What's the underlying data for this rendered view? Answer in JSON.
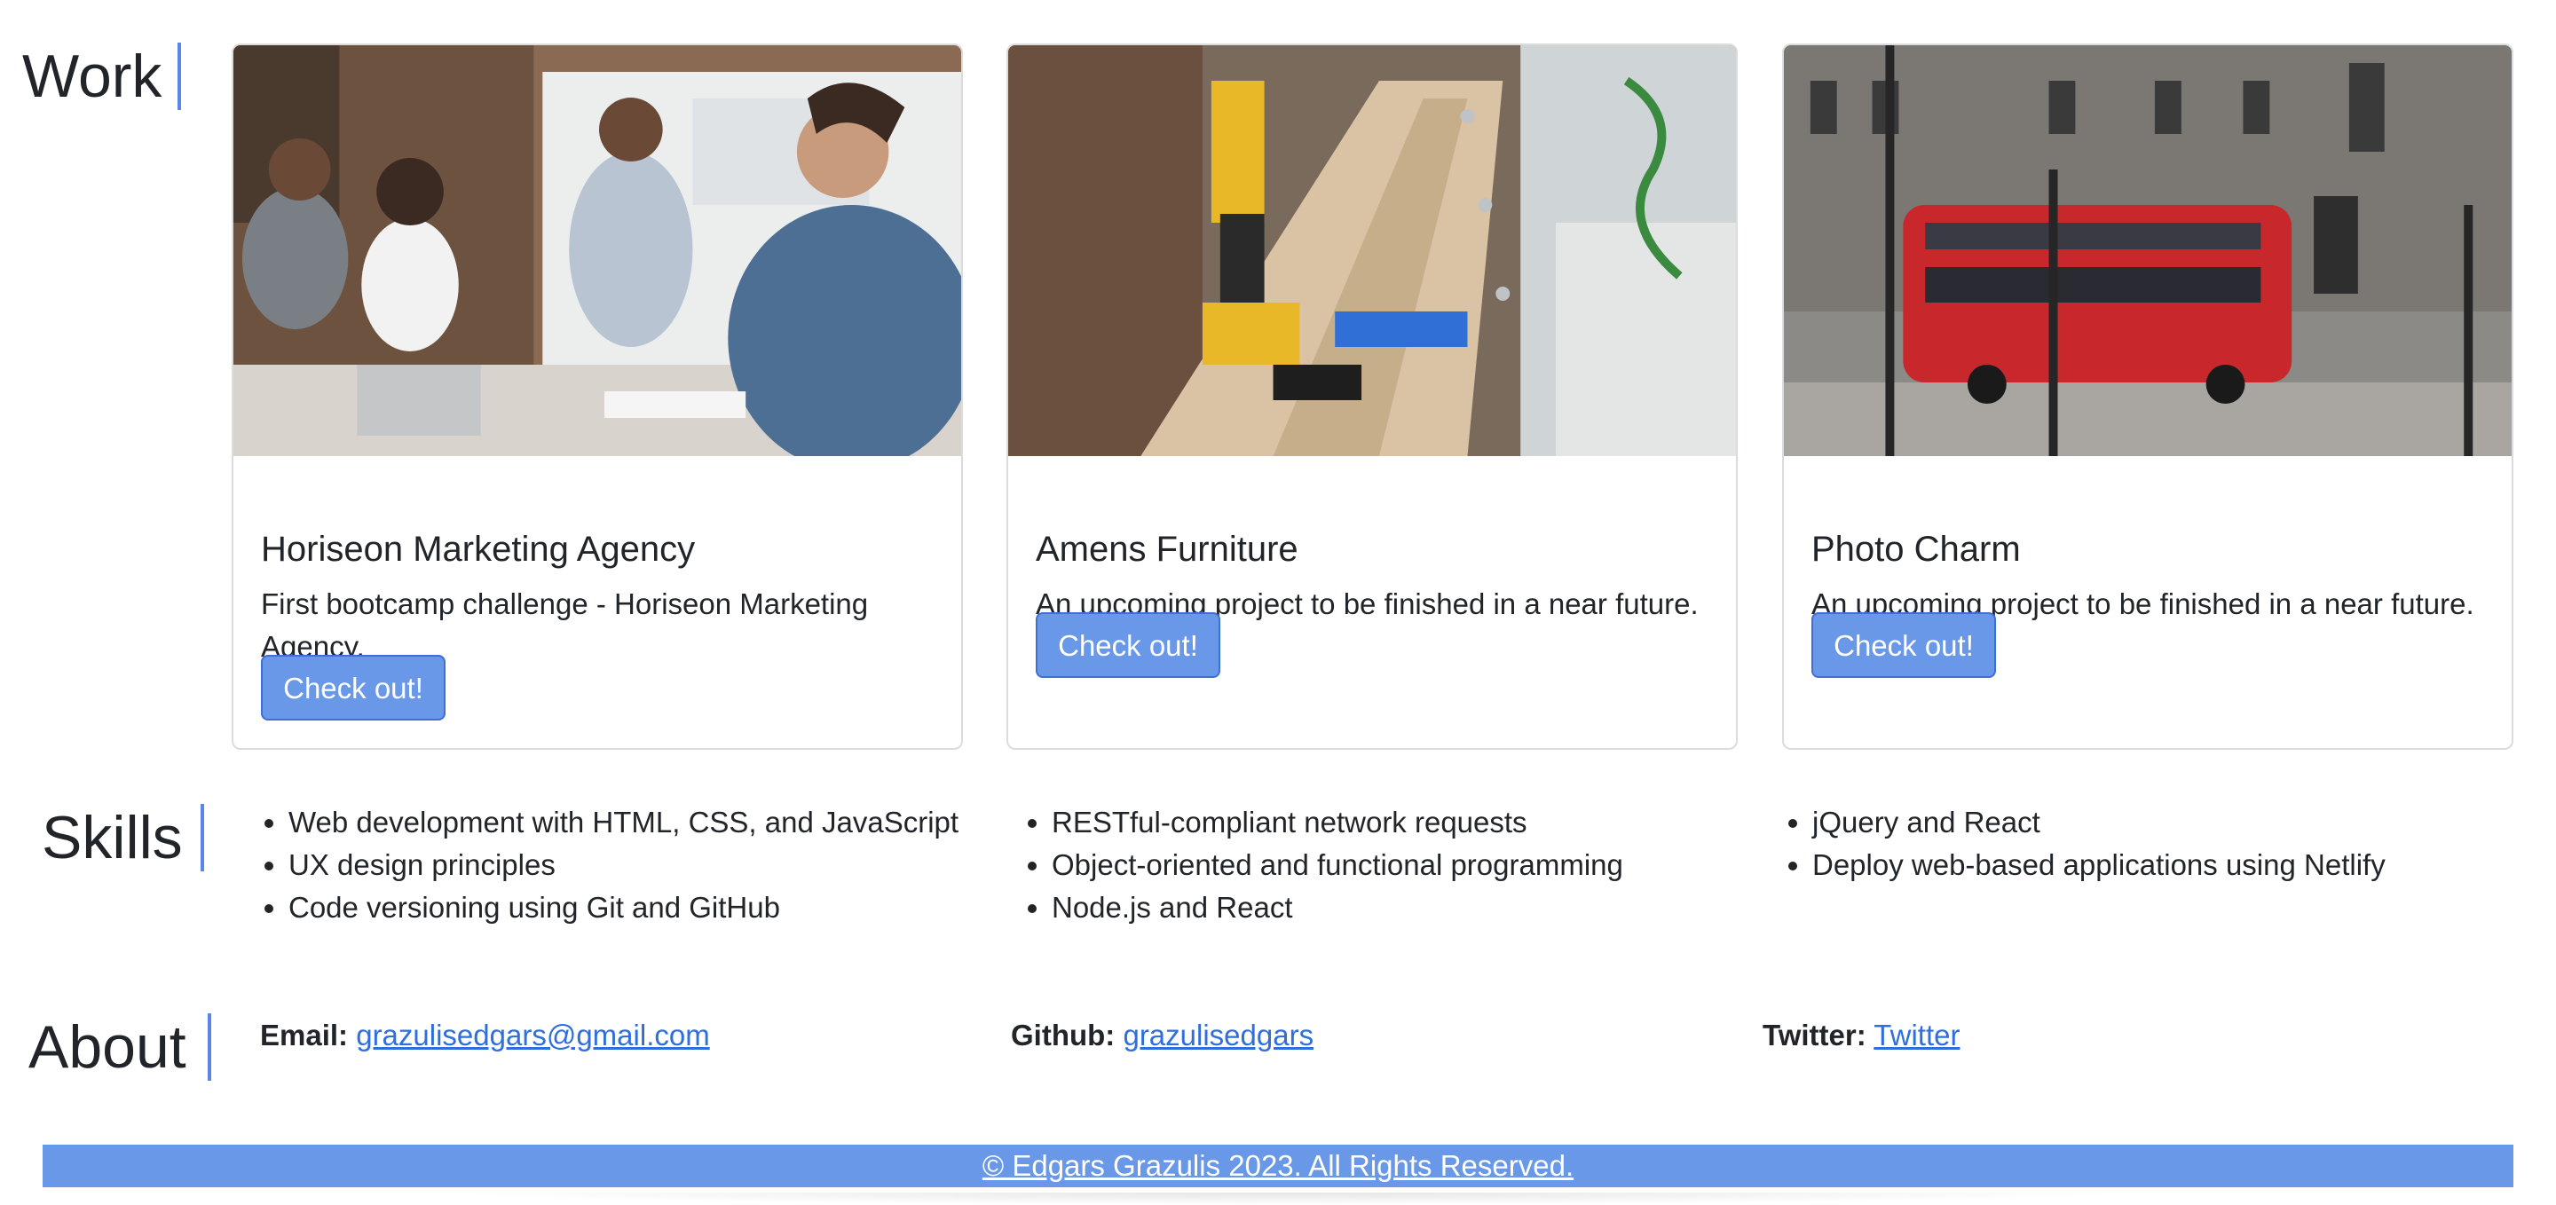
{
  "sections": {
    "work_title": "Work",
    "skills_title": "Skills",
    "about_title": "About"
  },
  "work": {
    "cards": [
      {
        "title": "Horiseon Marketing Agency",
        "text": "First bootcamp challenge - Horiseon Marketing Agency.",
        "button": "Check out!",
        "image": "office-team-meeting-photo"
      },
      {
        "title": "Amens Furniture",
        "text": "An upcoming project to be finished in a near future.",
        "button": "Check out!",
        "image": "power-tools-workbench-photo"
      },
      {
        "title": "Photo Charm",
        "text": "An upcoming project to be finished in a near future.",
        "button": "Check out!",
        "image": "red-london-bus-photo"
      }
    ]
  },
  "skills": {
    "columns": [
      [
        "Web development with HTML, CSS, and JavaScript",
        "UX design principles",
        "Code versioning using Git and GitHub"
      ],
      [
        "RESTful-compliant network requests",
        "Object-oriented and functional programming",
        "Node.js and React"
      ],
      [
        "jQuery and React",
        "Deploy web-based applications using Netlify"
      ]
    ]
  },
  "about": {
    "email_label": "Email:",
    "email_value": "grazulisedgars@gmail.com",
    "github_label": "Github:",
    "github_value": "grazulisedgars",
    "twitter_label": "Twitter:",
    "twitter_value": "Twitter"
  },
  "footer": {
    "text": "© Edgars Grazulis 2023. All Rights Reserved."
  },
  "colors": {
    "accent": "#6a98e8",
    "link": "#2f6fdc",
    "title_bar": "#5b86e5"
  }
}
